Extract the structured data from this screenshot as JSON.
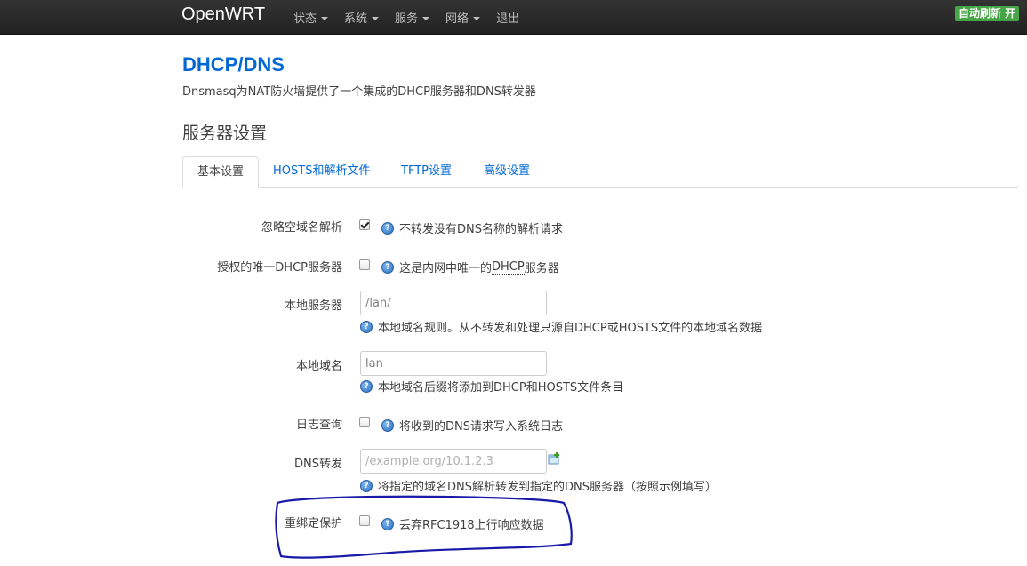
{
  "navbar": {
    "brand": "OpenWRT",
    "menu": [
      "状态",
      "系统",
      "服务",
      "网络",
      "退出"
    ],
    "autorefresh": "自动刷新 开"
  },
  "header": {
    "title": "DHCP/DNS",
    "description": "Dnsmasq为NAT防火墙提供了一个集成的DHCP服务器和DNS转发器",
    "section_title": "服务器设置"
  },
  "tabs": [
    "基本设置",
    "HOSTS和解析文件",
    "TFTP设置",
    "高级设置"
  ],
  "form": {
    "domainneeded": {
      "label": "忽略空域名解析",
      "checked": true,
      "help": "不转发没有DNS名称的解析请求"
    },
    "authoritative": {
      "label": "授权的唯一DHCP服务器",
      "checked": false,
      "help_prefix": "这是内网中唯一的",
      "help_link": "DHCP",
      "help_suffix": "服务器"
    },
    "local": {
      "label": "本地服务器",
      "value": "/lan/",
      "help": "本地域名规则。从不转发和处理只源自DHCP或HOSTS文件的本地域名数据"
    },
    "domain": {
      "label": "本地域名",
      "value": "lan",
      "help": "本地域名后缀将添加到DHCP和HOSTS文件条目"
    },
    "logqueries": {
      "label": "日志查询",
      "checked": false,
      "help": "将收到的DNS请求写入系统日志"
    },
    "server": {
      "label": "DNS转发",
      "placeholder": "/example.org/10.1.2.3",
      "help": "将指定的域名DNS解析转发到指定的DNS服务器（按照示例填写）"
    },
    "rebind_protection": {
      "label": "重绑定保护",
      "checked": false,
      "help": "丢弃RFC1918上行响应数据"
    }
  },
  "colors": {
    "accent": "#0069d6",
    "annotation": "#1a1aa8",
    "autorefresh": "#46a546"
  },
  "icons": [
    "help-icon",
    "add-icon",
    "caret-down-icon"
  ]
}
